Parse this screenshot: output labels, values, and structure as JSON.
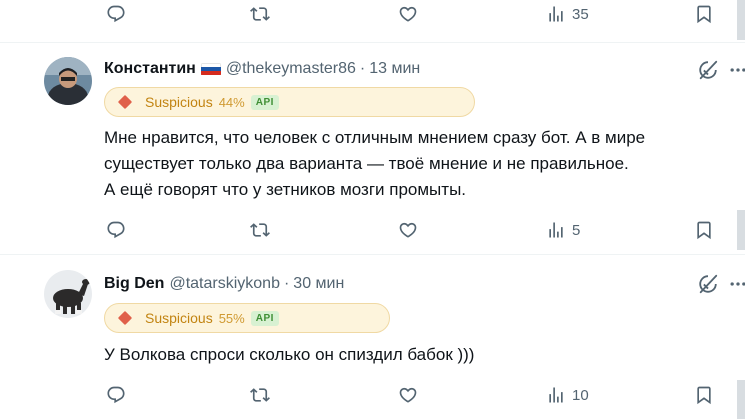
{
  "top_actions": {
    "views": "35"
  },
  "tweets": [
    {
      "name": "Константин",
      "flag_colors": [
        "#ffffff",
        "#1c57a7",
        "#d52b1e"
      ],
      "handle": "@thekeymaster86",
      "separator": "·",
      "time": "13 мин",
      "badge": {
        "label": "Suspicious",
        "percent": "44%",
        "source": "API"
      },
      "text_lines": [
        "Мне нравится, что человек с отличным мнением сразу бот. А в мире",
        "существует только два варианта — твоё мнение и не правильное.",
        "А ещё говорят что у зетников мозги промыты."
      ],
      "views": "5"
    },
    {
      "name": "Big Den",
      "handle": "@tatarskiykonb",
      "separator": "·",
      "time": "30 мин",
      "badge": {
        "label": "Suspicious",
        "percent": "55%",
        "source": "API"
      },
      "text_lines": [
        "У Волкова спроси сколько он спиздил бабок )))"
      ],
      "views": "10"
    }
  ],
  "icons": {
    "reply": "speech-bubble-icon",
    "retweet": "retweet-arrows-icon",
    "like": "heart-icon",
    "views": "bar-chart-icon",
    "bookmark": "bookmark-icon",
    "grok": "grok-slash-icon",
    "more": "ellipsis-icon"
  },
  "colors": {
    "text": "#0f1419",
    "muted": "#536471",
    "badge_bg": "#fdf4dc",
    "badge_text": "#c28412",
    "badge_diamond": "#e0604a",
    "api_bg": "#d8f1d2",
    "api_text": "#3f8f35"
  }
}
